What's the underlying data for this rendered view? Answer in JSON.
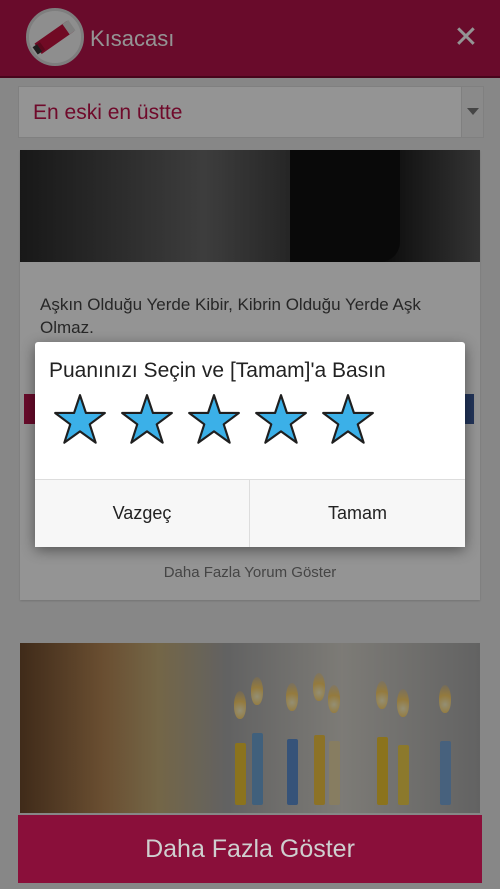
{
  "appbar": {
    "title": "Kısacası",
    "brand_color": "#b5134a",
    "close_icon": "close-icon"
  },
  "sort": {
    "selected": "En eski en üstte"
  },
  "post": {
    "quote": "Aşkın Olduğu Yerde Kibir, Kibrin Olduğu Yerde Aşk Olmaz.",
    "more_comments": "Daha Fazla Yorum Göster"
  },
  "footer": {
    "show_more": "Daha Fazla Göster"
  },
  "dialog": {
    "title": "Puanınızı Seçin ve [Tamam]'a Basın",
    "stars_total": 5,
    "stars_selected": 5,
    "star_color": "#3bb0e8",
    "cancel": "Vazgeç",
    "ok": "Tamam"
  }
}
